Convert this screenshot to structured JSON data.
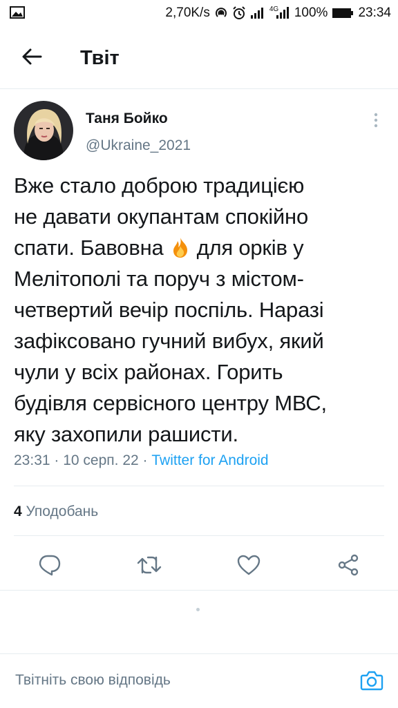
{
  "status_bar": {
    "speed": "2,70K/s",
    "network_type": "4G",
    "battery_percent": "100%",
    "time": "23:34",
    "icons": [
      "image-icon",
      "hotspot-icon",
      "alarm-icon",
      "signal-icon",
      "signal-4g-icon",
      "battery-icon"
    ]
  },
  "header": {
    "back_icon": "arrow-left-icon",
    "title": "Твіт"
  },
  "tweet": {
    "author_name": "Таня Бойко",
    "author_handle": "@Ukraine_2021",
    "more_icon": "more-vertical-icon",
    "lines": [
      "Вже стало доброю традицією",
      "не давати окупантам спокійно",
      "спати. Бавовна",
      "для орків у",
      "Мелітополі та поруч з містом-",
      "четвертий вечір поспіль. Наразі",
      "зафіксовано гучний вибух, який",
      "чули у всіх районах. Горить",
      "будівля сервісного центру МВС,",
      "яку захопили рашисти."
    ],
    "emoji": "fire-emoji",
    "time": "23:31",
    "separator": " · ",
    "date": "10 серп. 22",
    "source": "Twitter for Android",
    "likes_count": "4",
    "likes_label": "Уподобань"
  },
  "actions": [
    {
      "name": "reply-icon"
    },
    {
      "name": "retweet-icon"
    },
    {
      "name": "like-icon"
    },
    {
      "name": "share-icon"
    }
  ],
  "reply": {
    "placeholder": "Твітніть свою відповідь",
    "camera_icon": "camera-icon"
  },
  "colors": {
    "accent": "#1da1f2",
    "text": "#14171a",
    "secondary_text": "#657786",
    "divider": "#e6ecf0"
  }
}
